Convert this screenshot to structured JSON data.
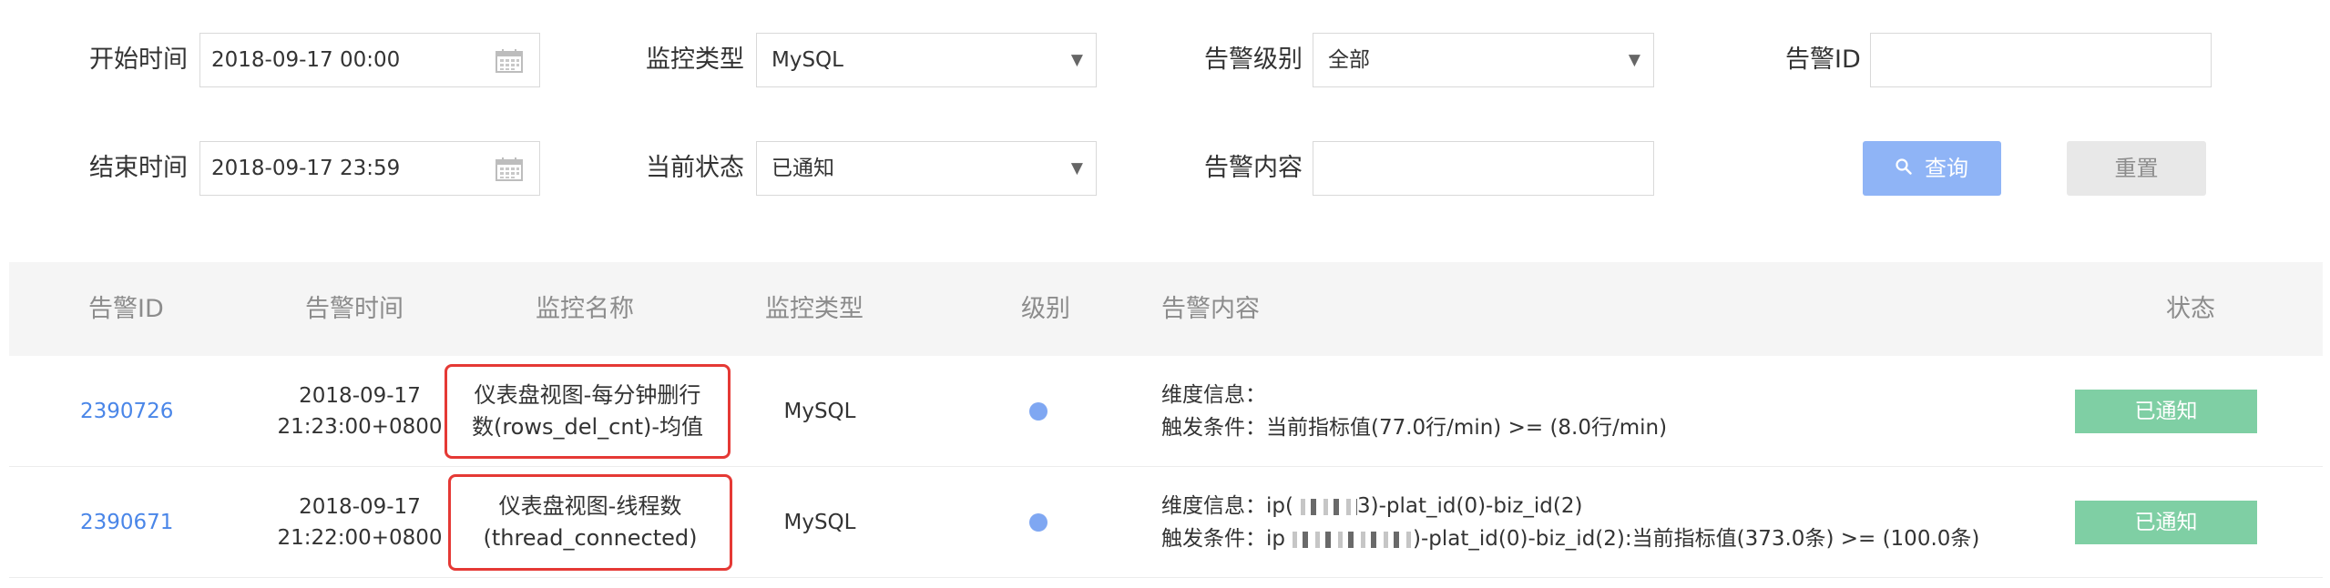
{
  "filters": {
    "start_time": {
      "label": "开始时间",
      "value": "2018-09-17 00:00"
    },
    "end_time": {
      "label": "结束时间",
      "value": "2018-09-17 23:59"
    },
    "monitor_type": {
      "label": "监控类型",
      "value": "MySQL"
    },
    "current_status": {
      "label": "当前状态",
      "value": "已通知"
    },
    "alert_level": {
      "label": "告警级别",
      "value": "全部"
    },
    "alert_content": {
      "label": "告警内容",
      "value": ""
    },
    "alert_id": {
      "label": "告警ID",
      "value": ""
    },
    "query_label": "查询",
    "reset_label": "重置"
  },
  "table": {
    "columns": [
      "告警ID",
      "告警时间",
      "监控名称",
      "监控类型",
      "级别",
      "告警内容",
      "状态"
    ],
    "rows": [
      {
        "id": "2390726",
        "time_date": "2018-09-17",
        "time_clock": "21:23:00+0800",
        "name_line1": "仪表盘视图-每分钟删行",
        "name_line2": "数(rows_del_cnt)-均值",
        "type": "MySQL",
        "content_line1": "维度信息：",
        "content_line2": "触发条件：当前指标值(77.0行/min) >= (8.0行/min)",
        "status": "已通知"
      },
      {
        "id": "2390671",
        "time_date": "2018-09-17",
        "time_clock": "21:22:00+0800",
        "name_line1": "仪表盘视图-线程数",
        "name_line2": "(thread_connected)",
        "type": "MySQL",
        "content_line1_prefix": "维度信息：ip(",
        "content_line1_suffix": "3)-plat_id(0)-biz_id(2)",
        "content_line2_prefix": "触发条件：ip",
        "content_line2_suffix": ")-plat_id(0)-biz_id(2):当前指标值(373.0条) >= (100.0条)",
        "status": "已通知"
      }
    ]
  },
  "colors": {
    "link": "#4a86e8",
    "query_button": "#8fb4f6",
    "status_badge": "#7fcfa4",
    "highlight_border": "#e53935",
    "level_dot": "#7fa7f2"
  },
  "icons": {
    "date_picker": "calendar-icon",
    "dropdown": "caret-down-icon",
    "query": "search-icon"
  }
}
